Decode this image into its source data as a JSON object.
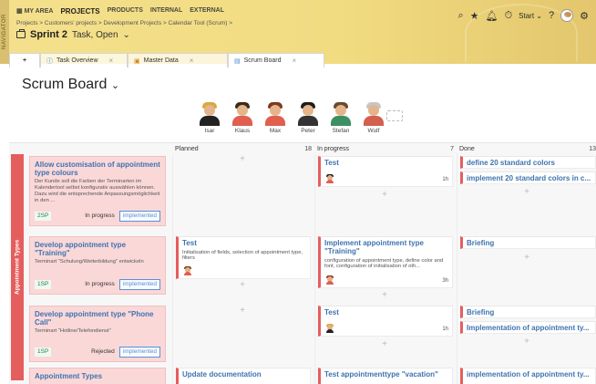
{
  "navigator_label": "NAVIGATOR",
  "topmenu": {
    "my_area": "MY AREA",
    "projects": "PROJECTS",
    "products": "PRODUCTS",
    "internal": "INTERNAL",
    "external": "EXTERNAL"
  },
  "breadcrumb": "Projects > Customers' projects > Development Projects > Calendar Tool (Scrum) >",
  "sprint": {
    "name": "Sprint 2",
    "meta": "Task, Open"
  },
  "tools": {
    "start_label": "Start"
  },
  "tabs": [
    {
      "label": "Task Overview"
    },
    {
      "label": "Master Data"
    },
    {
      "label": "Scrum Board"
    }
  ],
  "page": {
    "title": "Scrum Board"
  },
  "people": [
    {
      "name": "Isar"
    },
    {
      "name": "Klaus"
    },
    {
      "name": "Max"
    },
    {
      "name": "Peter"
    },
    {
      "name": "Stefan"
    },
    {
      "name": "Wulf"
    }
  ],
  "columns": {
    "planned": {
      "label": "Planned",
      "count": "18"
    },
    "in_progress": {
      "label": "In progress",
      "count": "7"
    },
    "done": {
      "label": "Done",
      "count": "13"
    }
  },
  "swimlane": "Appointment Types",
  "stories": [
    {
      "title": "Allow customisation of appointment type colours",
      "desc": "Der Kunde soll die Farben der Terminarten im Kalendertool selbst konfigurativ auswählen können. Dazu wird die entsprechende Anpassungsmöglichkeit in den ...",
      "sp": "2SP",
      "status": "In progress",
      "tag": "implemented"
    },
    {
      "title": "Develop appointment type \"Training\"",
      "desc": "Terminart \"Schulung/Weiterbildung\" entwickeln",
      "sp": "1SP",
      "status": "In progress",
      "tag": "implemented"
    },
    {
      "title": "Develop appointment type \"Phone Call\"",
      "desc": "Terminart \"Hotline/Telefondienst\"",
      "sp": "1SP",
      "status": "Rejected",
      "tag": "implemented"
    },
    {
      "title": "Appointment Types",
      "desc": "",
      "sp": "",
      "status": "",
      "tag": ""
    }
  ],
  "cards": {
    "r1_progress": {
      "title": "Test",
      "time": "1h"
    },
    "r1_done_1": {
      "title": "define 20 standard colors"
    },
    "r1_done_2": {
      "title": "implement 20 standard colors in c..."
    },
    "r2_planned": {
      "title": "Test",
      "desc": "Initialisation of fields, selection of appointment type, filters"
    },
    "r2_progress": {
      "title": "Implement appointment type \"Training\"",
      "desc": "configuration of appointment type, define color and font, configuration of initialisation of oth...",
      "time": "3h"
    },
    "r2_done": {
      "title": "Briefing"
    },
    "r3_progress": {
      "title": "Test",
      "time": "1h"
    },
    "r3_done_1": {
      "title": "Briefing"
    },
    "r3_done_2": {
      "title": "Implementation of appointment ty..."
    },
    "r4_planned": {
      "title": "Update documentation"
    },
    "r4_progress": {
      "title": "Test appointmenttype \"vacation\""
    },
    "r4_done": {
      "title": "implementation of appointment ty..."
    }
  }
}
